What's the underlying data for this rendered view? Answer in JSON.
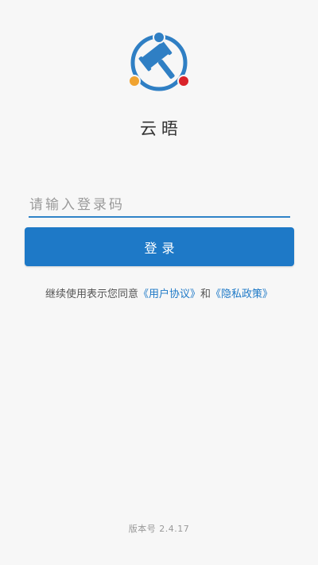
{
  "app": {
    "name": "云晤"
  },
  "login": {
    "code_placeholder": "请输入登录码",
    "code_value": "",
    "submit_label": "登录"
  },
  "agreement": {
    "prefix": "继续使用表示您同意",
    "user_agreement": "《用户协议》",
    "connector": "和",
    "privacy_policy": "《隐私政策》"
  },
  "footer": {
    "version_text": "版本号 2.4.17"
  },
  "theme": {
    "primary": "#1e79c7",
    "logo_ring": "#2f7fc4",
    "logo_dot_top": "#2f7fc4",
    "logo_dot_left": "#f0a330",
    "logo_dot_right": "#d9232a",
    "background": "#f7f7f7"
  },
  "icons": {
    "logo": "gavel-ring-logo-icon"
  }
}
